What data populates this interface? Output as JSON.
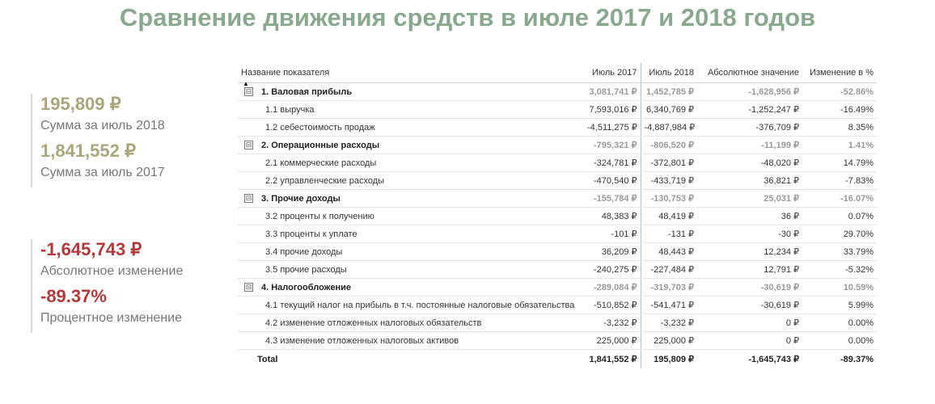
{
  "title": "Сравнение движения средств в июле 2017 и 2018 годов",
  "kpis": {
    "sum2018": {
      "value": "195,809 ₽",
      "label": "Сумма за июль 2018"
    },
    "sum2017": {
      "value": "1,841,552 ₽",
      "label": "Сумма за июль 2017"
    },
    "abs": {
      "value": "-1,645,743 ₽",
      "label": "Абсолютное изменение"
    },
    "pct": {
      "value": "-89.37%",
      "label": "Процентное изменение"
    }
  },
  "table": {
    "headers": {
      "name": "Название показателя",
      "jul2017": "Июль 2017",
      "jul2018": "Июль 2018",
      "abs": "Абсолютное значение",
      "pct": "Изменение в %"
    },
    "sort_indicator": "▲",
    "collapse_glyph": "⊟",
    "rows": [
      {
        "type": "group",
        "name": "1. Валовая прибыль",
        "v2017": "3,081,741 ₽",
        "v2018": "1,452,785 ₽",
        "abs": "-1,628,956 ₽",
        "pct": "-52.86%"
      },
      {
        "type": "child",
        "name": "1.1 выручка",
        "v2017": "7,593,016 ₽",
        "v2018": "6,340,769 ₽",
        "abs": "-1,252,247 ₽",
        "pct": "-16.49%"
      },
      {
        "type": "child",
        "name": "1.2 себестоимость продаж",
        "v2017": "-4,511,275 ₽",
        "v2018": "-4,887,984 ₽",
        "abs": "-376,709 ₽",
        "pct": "8.35%"
      },
      {
        "type": "group",
        "name": "2. Операционные расходы",
        "v2017": "-795,321 ₽",
        "v2018": "-806,520 ₽",
        "abs": "-11,199 ₽",
        "pct": "1.41%"
      },
      {
        "type": "child",
        "name": "2.1 коммерческие расходы",
        "v2017": "-324,781 ₽",
        "v2018": "-372,801 ₽",
        "abs": "-48,020 ₽",
        "pct": "14.79%"
      },
      {
        "type": "child",
        "name": "2.2 управленческие расходы",
        "v2017": "-470,540 ₽",
        "v2018": "-433,719 ₽",
        "abs": "36,821 ₽",
        "pct": "-7.83%"
      },
      {
        "type": "group",
        "name": "3. Прочие доходы",
        "v2017": "-155,784 ₽",
        "v2018": "-130,753 ₽",
        "abs": "25,031 ₽",
        "pct": "-16.07%"
      },
      {
        "type": "child",
        "name": "3.2 проценты к получению",
        "v2017": "48,383 ₽",
        "v2018": "48,419 ₽",
        "abs": "36 ₽",
        "pct": "0.07%"
      },
      {
        "type": "child",
        "name": "3.3 проценты к уплате",
        "v2017": "-101 ₽",
        "v2018": "-131 ₽",
        "abs": "-30 ₽",
        "pct": "29.70%"
      },
      {
        "type": "child",
        "name": "3.4 прочие доходы",
        "v2017": "36,209 ₽",
        "v2018": "48,443 ₽",
        "abs": "12,234 ₽",
        "pct": "33.79%"
      },
      {
        "type": "child",
        "name": "3.5 прочие расходы",
        "v2017": "-240,275 ₽",
        "v2018": "-227,484 ₽",
        "abs": "12,791 ₽",
        "pct": "-5.32%"
      },
      {
        "type": "group",
        "name": "4. Налогообложение",
        "v2017": "-289,084 ₽",
        "v2018": "-319,703 ₽",
        "abs": "-30,619 ₽",
        "pct": "10.59%"
      },
      {
        "type": "child",
        "name": "4.1 текущий налог на прибыль в т.ч. постоянные налоговые обязательства",
        "v2017": "-510,852 ₽",
        "v2018": "-541,471 ₽",
        "abs": "-30,619 ₽",
        "pct": "5.99%"
      },
      {
        "type": "child",
        "name": "4.2 изменение отложенных налоговых обязательств",
        "v2017": "-3,232 ₽",
        "v2018": "-3,232 ₽",
        "abs": "0 ₽",
        "pct": "0.00%"
      },
      {
        "type": "child",
        "name": "4.3 изменение отложенных налоговых активов",
        "v2017": "225,000 ₽",
        "v2018": "225,000 ₽",
        "abs": "0 ₽",
        "pct": "0.00%"
      }
    ],
    "total": {
      "name": "Total",
      "v2017": "1,841,552 ₽",
      "v2018": "195,809 ₽",
      "abs": "-1,645,743 ₽",
      "pct": "-89.37%"
    }
  }
}
